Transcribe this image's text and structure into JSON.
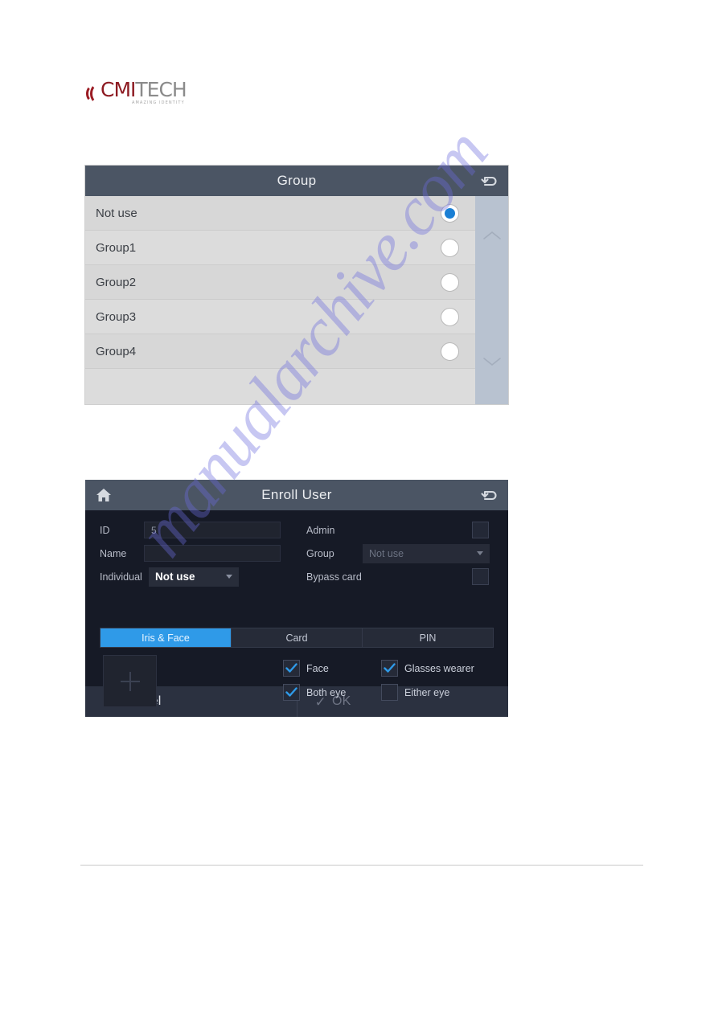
{
  "brand": {
    "name_part1": "CMI",
    "name_part2": "TECH",
    "tagline": "AMAZING IDENTITY",
    "mark_icon": "cmitech-arc-logo-icon",
    "color_primary": "#8d1b22",
    "color_secondary": "#8b8b8b"
  },
  "watermark": {
    "text": "manualarchive.com",
    "color": "#6c6cdc"
  },
  "group_dialog": {
    "title": "Group",
    "back_icon": "back-arrow-icon",
    "header_color": "#4b5564",
    "accent_color": "#1a7fd4",
    "scroll_up_icon": "chevron-up-icon",
    "scroll_down_icon": "chevron-down-icon",
    "items": [
      {
        "label": "Not use",
        "selected": true
      },
      {
        "label": "Group1",
        "selected": false
      },
      {
        "label": "Group2",
        "selected": false
      },
      {
        "label": "Group3",
        "selected": false
      },
      {
        "label": "Group4",
        "selected": false
      }
    ]
  },
  "enroll_dialog": {
    "title": "Enroll User",
    "home_icon": "home-icon",
    "back_icon": "back-arrow-icon",
    "header_color": "#4b5564",
    "accent_color": "#2f9ae8",
    "fields": {
      "id_label": "ID",
      "id_value": "5",
      "name_label": "Name",
      "name_value": "",
      "individual_label": "Individual",
      "individual_value": "Not use",
      "admin_label": "Admin",
      "admin_checked": false,
      "group_label": "Group",
      "group_value": "Not use",
      "bypass_label": "Bypass card",
      "bypass_checked": false
    },
    "tabs": [
      {
        "label": "Iris & Face",
        "active": true
      },
      {
        "label": "Card",
        "active": false
      },
      {
        "label": "PIN",
        "active": false
      }
    ],
    "photo": {
      "add_icon": "plus-icon"
    },
    "options": [
      {
        "label": "Face",
        "checked": true
      },
      {
        "label": "Glasses wearer",
        "checked": true
      },
      {
        "label": "Both eye",
        "checked": true
      },
      {
        "label": "Either eye",
        "checked": false
      }
    ],
    "footer": {
      "cancel_glyph": "✕",
      "cancel_label": "Cancel",
      "ok_glyph": "✓",
      "ok_label": "OK"
    }
  }
}
